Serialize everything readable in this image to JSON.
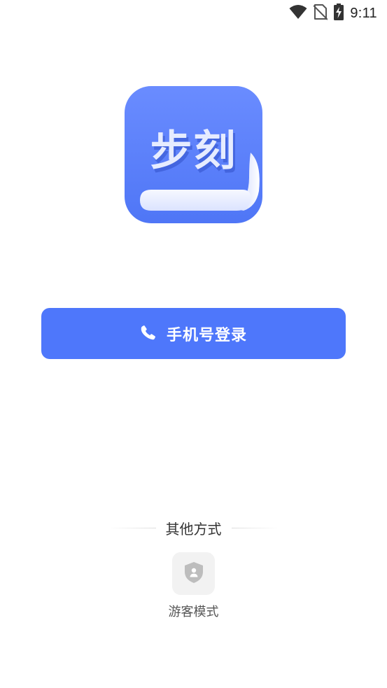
{
  "status_bar": {
    "time": "9:11",
    "icons": [
      "wifi-icon",
      "no-sim-icon",
      "battery-charging-icon"
    ]
  },
  "logo": {
    "text": "步刻",
    "icon": "book-logo",
    "colors": {
      "primary": "#5b80fa",
      "text": "#e6ecff"
    }
  },
  "login": {
    "label": "手机号登录",
    "icon": "phone-icon",
    "color": "#4e77fb"
  },
  "other_methods": {
    "title": "其他方式",
    "options": [
      {
        "label": "游客模式",
        "icon": "shield-user-icon"
      }
    ]
  }
}
